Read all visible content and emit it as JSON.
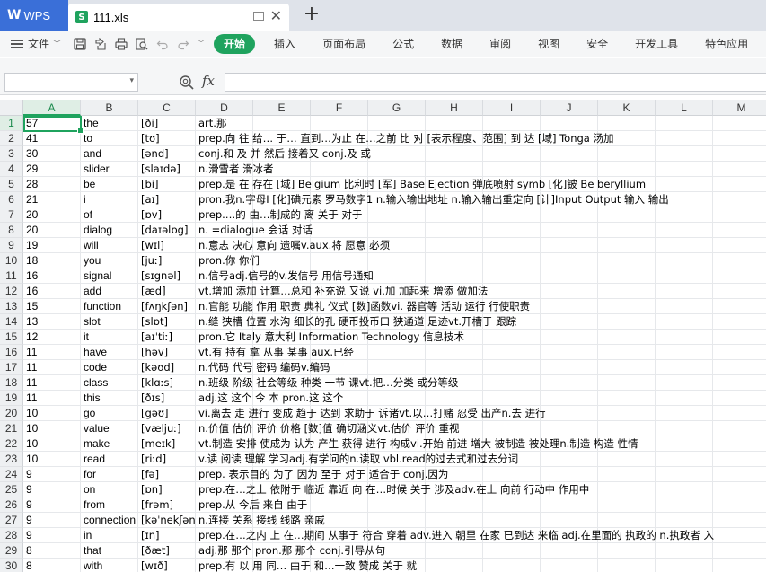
{
  "tabs": {
    "app": "WPS",
    "file": "111.xls",
    "add": "+"
  },
  "ribbon": {
    "file_menu": "文件",
    "tabs": [
      "开始",
      "插入",
      "页面布局",
      "公式",
      "数据",
      "审阅",
      "视图",
      "安全",
      "开发工具",
      "特色应用"
    ],
    "active_tab": "开始"
  },
  "formula_bar": {
    "name_box": "",
    "fx_label": "fx",
    "content": ""
  },
  "columns": [
    "A",
    "B",
    "C",
    "D",
    "E",
    "F",
    "G",
    "H",
    "I",
    "J",
    "K",
    "L",
    "M"
  ],
  "selected_column": "A",
  "rows": [
    {
      "n": "1",
      "a": "57",
      "b": "the",
      "c": "[ði]",
      "d": "art.那"
    },
    {
      "n": "2",
      "a": "41",
      "b": "to",
      "c": "[tʊ]",
      "d": "prep.向 往 给… 于… 直到…为止 在…之前 比 对 [表示程度、范围] 到 达 [域] Tonga 汤加"
    },
    {
      "n": "3",
      "a": "30",
      "b": "and",
      "c": "[ənd]",
      "d": "conj.和 及 并 然后 接着又  conj.及 或"
    },
    {
      "n": "4",
      "a": "29",
      "b": "slider",
      "c": "[slaɪdə]",
      "d": "n.滑雪者 滑冰者"
    },
    {
      "n": "5",
      "a": "28",
      "b": "be",
      "c": "[bi]",
      "d": "prep.是 在 存在 [域] Belgium  比利时 [军] Base Ejection 弹底喷射 symb [化]铍 Be beryllium"
    },
    {
      "n": "6",
      "a": "21",
      "b": "i",
      "c": "[aɪ]",
      "d": "pron.我n.字母I [化]碘元素 罗马数字1  n.输入输出地址  n.输入输出重定向  [计]Input Output 输入 输出"
    },
    {
      "n": "7",
      "a": "20",
      "b": "of",
      "c": "[ɒv]",
      "d": "prep.…的 由…制成的 离 关于 对于"
    },
    {
      "n": "8",
      "a": "20",
      "b": "dialog",
      "c": "[daɪəlɒg]",
      "d": "n. =dialogue 会话 对话"
    },
    {
      "n": "9",
      "a": "19",
      "b": "will",
      "c": "[wɪl]",
      "d": "n.意志 决心 意向 遗嘱v.aux.将 愿意 必须"
    },
    {
      "n": "10",
      "a": "18",
      "b": "you",
      "c": "[juː]",
      "d": "pron.你 你们"
    },
    {
      "n": "11",
      "a": "16",
      "b": "signal",
      "c": "[sɪgnəl]",
      "d": "n.信号adj.信号的v.发信号 用信号通知"
    },
    {
      "n": "12",
      "a": "16",
      "b": "add",
      "c": "[æd]",
      "d": "vt.增加 添加 计算…总和 补充说 又说 vi.加 加起来 增添 做加法"
    },
    {
      "n": "13",
      "a": "15",
      "b": "function",
      "c": "[fʌŋkʃən]",
      "d": "n.官能 功能 作用 职责 典礼 仪式 [数]函数vi. 器官等 活动 运行 行使职责"
    },
    {
      "n": "14",
      "a": "13",
      "b": "slot",
      "c": "[slɒt]",
      "d": "n.缝 狭槽 位置 水沟 细长的孔 硬币投币口 狭通道 足迹vt.开槽于 跟踪"
    },
    {
      "n": "15",
      "a": "12",
      "b": "it",
      "c": "[aɪˈtiː]",
      "d": "pron.它 Italy 意大利 Information Technology 信息技术"
    },
    {
      "n": "16",
      "a": "11",
      "b": "have",
      "c": "[həv]",
      "d": "vt.有 持有 拿 从事 某事  aux.已经"
    },
    {
      "n": "17",
      "a": "11",
      "b": "code",
      "c": "[kəʊd]",
      "d": "n.代码 代号 密码 编码v.编码"
    },
    {
      "n": "18",
      "a": "11",
      "b": "class",
      "c": "[klɑːs]",
      "d": "n.班级 阶级 社会等级 种类  一节 课vt.把…分类 或分等级"
    },
    {
      "n": "19",
      "a": "11",
      "b": "this",
      "c": "[ðɪs]",
      "d": "adj.这 这个 今 本 pron.这 这个"
    },
    {
      "n": "20",
      "a": "10",
      "b": "go",
      "c": "[gəʊ]",
      "d": "vi.离去 走 进行 变成 趋于 达到 求助于 诉诸vt.以…打赌 忍受 出产n.去 进行"
    },
    {
      "n": "21",
      "a": "10",
      "b": "value",
      "c": "[væljuː]",
      "d": "n.价值 估价 评价 价格 [数]值 确切涵义vt.估价 评价 重视"
    },
    {
      "n": "22",
      "a": "10",
      "b": "make",
      "c": "[meɪk]",
      "d": "vt.制造 安排 使成为 认为 产生 获得 进行 构成vi.开始 前进 增大 被制造 被处理n.制造 构造 性情"
    },
    {
      "n": "23",
      "a": "10",
      "b": "read",
      "c": "[riːd]",
      "d": "v.读 阅读 理解 学习adj.有学问的n.读取 vbl.read的过去式和过去分词"
    },
    {
      "n": "24",
      "a": "9",
      "b": "for",
      "c": "[fə]",
      "d": "prep. 表示目的 为了 因为 至于 对于 适合于 conj.因为"
    },
    {
      "n": "25",
      "a": "9",
      "b": "on",
      "c": "[ɒn]",
      "d": "prep.在…之上 依附于 临近 靠近 向 在…时候 关于 涉及adv.在上 向前 行动中 作用中"
    },
    {
      "n": "26",
      "a": "9",
      "b": "from",
      "c": "[frəm]",
      "d": "prep.从 今后 来自 由于"
    },
    {
      "n": "27",
      "a": "9",
      "b": "connection",
      "c": "[kəˈnekʃən]",
      "d": "n.连接 关系 接线 线路 亲戚"
    },
    {
      "n": "28",
      "a": "9",
      "b": "in",
      "c": "[ɪn]",
      "d": "prep.在…之内 上  在…期间 从事于 符合 穿着 adv.进入 朝里 在家 已到达 来临 adj.在里面的 执政的 n.执政者 入"
    },
    {
      "n": "29",
      "a": "8",
      "b": "that",
      "c": "[ðæt]",
      "d": "adj.那 那个 pron.那 那个 conj.引导从句"
    },
    {
      "n": "30",
      "a": "8",
      "b": "with",
      "c": "[wɪð]",
      "d": "prep.有 以 用 同… 由于 和…一致 赞成 关于 就"
    }
  ]
}
